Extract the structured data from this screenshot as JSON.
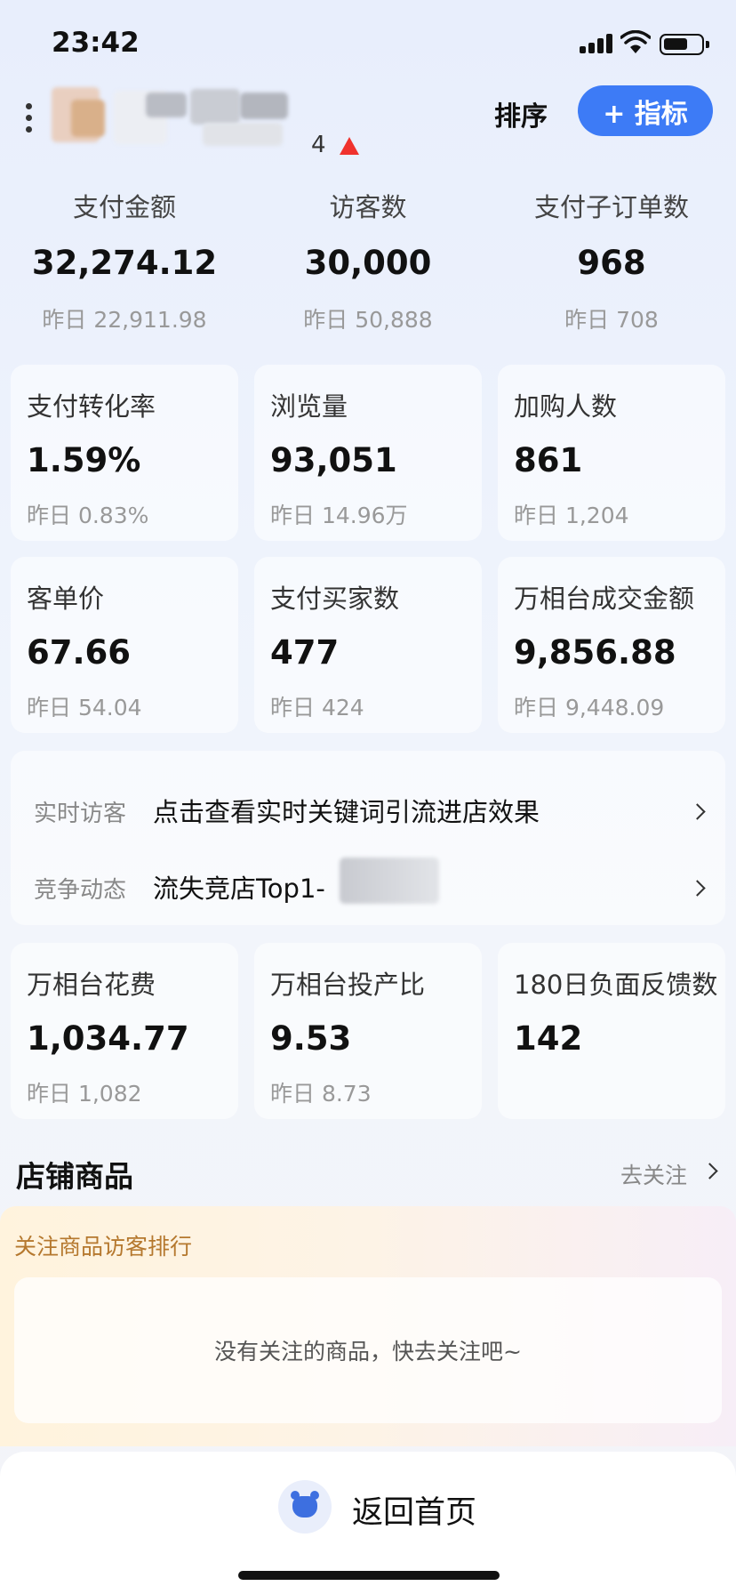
{
  "status_bar": {
    "time": "23:42"
  },
  "header": {
    "shop_name_suffix": "4",
    "sort_label": "排序",
    "add_metric_label": "+ 指标"
  },
  "summary": [
    {
      "label": "支付金额",
      "value": "32,274.12",
      "prev": "昨日 22,911.98"
    },
    {
      "label": "访客数",
      "value": "30,000",
      "prev": "昨日 50,888"
    },
    {
      "label": "支付子订单数",
      "value": "968",
      "prev": "昨日 708"
    }
  ],
  "cards": [
    {
      "label": "支付转化率",
      "value": "1.59%",
      "prev": "昨日 0.83%"
    },
    {
      "label": "浏览量",
      "value": "93,051",
      "prev": "昨日 14.96万"
    },
    {
      "label": "加购人数",
      "value": "861",
      "prev": "昨日 1,204"
    },
    {
      "label": "客单价",
      "value": "67.66",
      "prev": "昨日 54.04"
    },
    {
      "label": "支付买家数",
      "value": "477",
      "prev": "昨日 424"
    },
    {
      "label": "万相台成交金额",
      "value": "9,856.88",
      "prev": "昨日 9,448.09"
    },
    {
      "label": "万相台花费",
      "value": "1,034.77",
      "prev": "昨日 1,082"
    },
    {
      "label": "万相台投产比",
      "value": "9.53",
      "prev": "昨日 8.73"
    },
    {
      "label": "180日负面反馈数",
      "value": "142",
      "prev": ""
    }
  ],
  "info": {
    "realtime_tag": "实时访客",
    "realtime_text": "点击查看实时关键词引流进店效果",
    "competition_tag": "竞争动态",
    "competition_text": "流失竞店Top1-"
  },
  "store_products": {
    "title": "店铺商品",
    "follow_link": "去关注",
    "rank_title": "关注商品访客排行",
    "empty_text": "没有关注的商品，快去关注吧~"
  },
  "bottom": {
    "home_label": "返回首页"
  }
}
